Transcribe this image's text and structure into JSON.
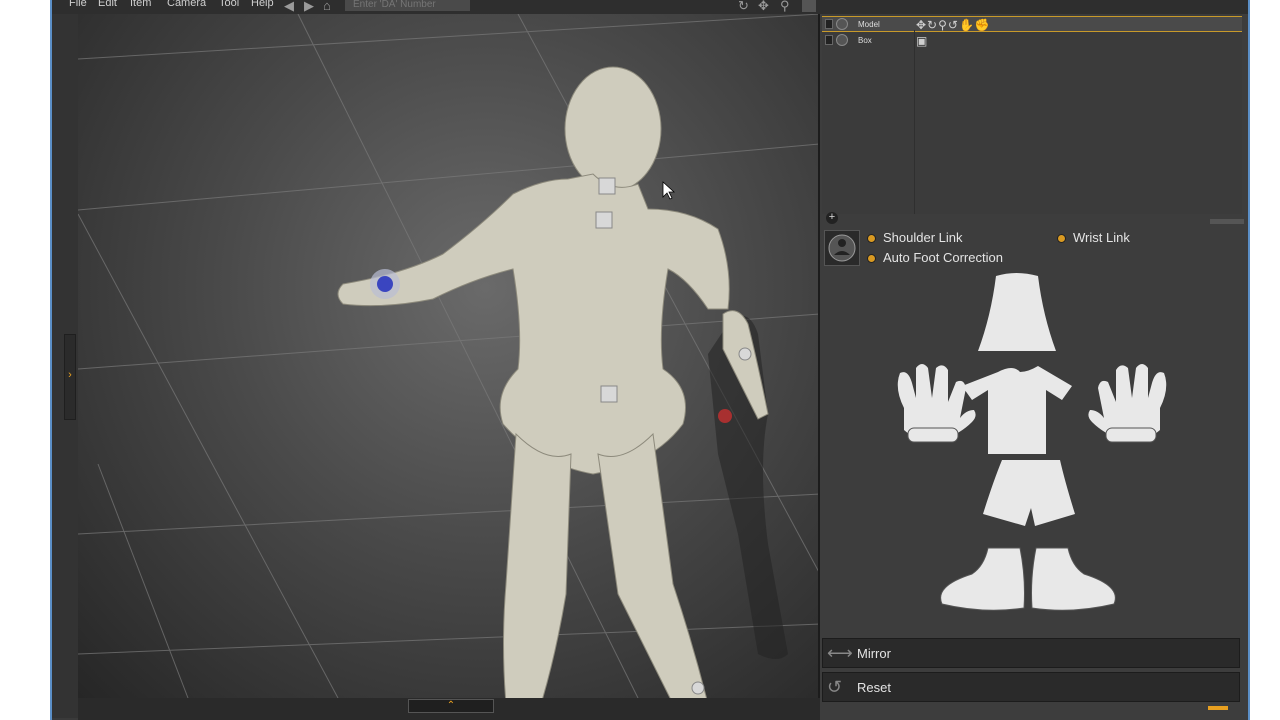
{
  "menu": {
    "items": [
      "File",
      "Edit",
      "Item",
      "Camera",
      "Tool",
      "Help"
    ],
    "search_placeholder": "Enter 'DA' Number"
  },
  "toolbar_icons": [
    "undo-icon",
    "redo-icon",
    "home-icon",
    "rotate-icon",
    "move-icon",
    "zoom-icon",
    "camera-icon"
  ],
  "scene": {
    "rows": [
      {
        "name": "Model",
        "selected": true
      },
      {
        "name": "Box",
        "selected": false
      }
    ]
  },
  "options": {
    "shoulder_link": "Shoulder Link",
    "wrist_link": "Wrist Link",
    "auto_foot": "Auto Foot Correction"
  },
  "body_parts": [
    "head",
    "left-hand",
    "torso",
    "right-hand",
    "hips",
    "left-foot",
    "right-foot"
  ],
  "buttons": {
    "mirror": "Mirror",
    "reset": "Reset"
  },
  "colors": {
    "accent": "#e8a020",
    "selection": "#c89a2a",
    "panel": "#3d3d3d"
  }
}
